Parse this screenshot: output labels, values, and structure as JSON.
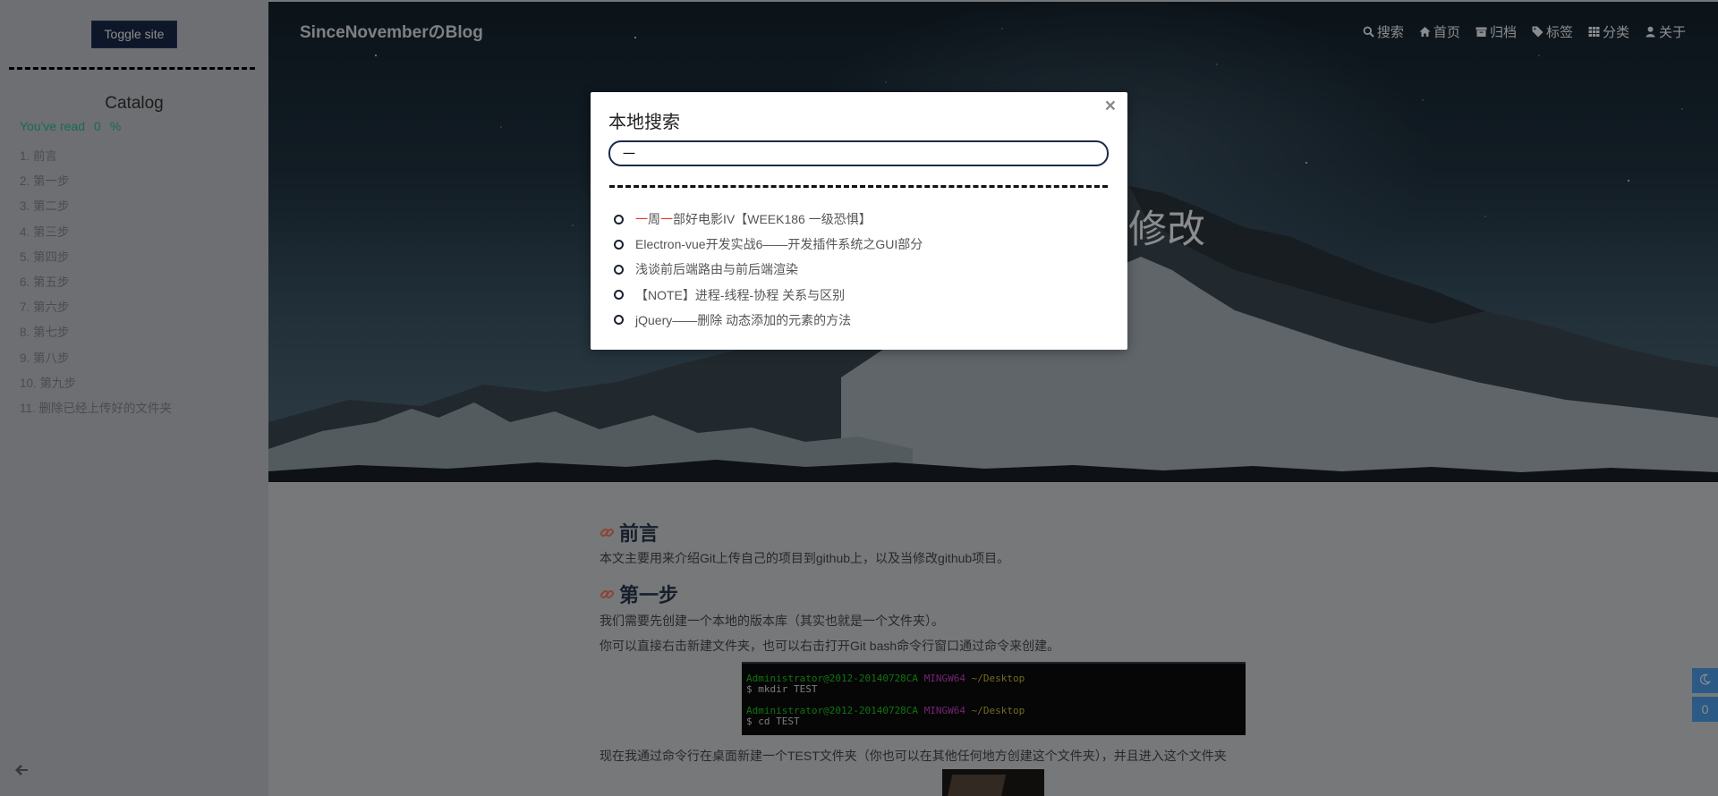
{
  "colors": {
    "accent": "#192a4b",
    "highlight": "#e8352c",
    "read_progress": "#2fc48e",
    "float_button": "#4ea4f2"
  },
  "sidebar": {
    "toggle_label": "Toggle site",
    "catalog_title": "Catalog",
    "progress": {
      "prefix": "You've read",
      "value": "0",
      "suffix": "%"
    },
    "items": [
      "1. 前言",
      "2. 第一步",
      "3. 第二步",
      "4. 第三步",
      "5. 第四步",
      "6. 第五步",
      "7. 第六步",
      "8. 第七步",
      "9. 第八步",
      "10. 第九步",
      "11. 删除已经上传好的文件夹"
    ],
    "back_icon": "arrow-left-icon"
  },
  "nav": {
    "brand": "SinceNovemberのBlog",
    "items": [
      {
        "icon": "search-icon",
        "label": "搜索"
      },
      {
        "icon": "home-icon",
        "label": "首页"
      },
      {
        "icon": "archive-icon",
        "label": "归档"
      },
      {
        "icon": "tag-icon",
        "label": "标签"
      },
      {
        "icon": "grid-icon",
        "label": "分类"
      },
      {
        "icon": "user-icon",
        "label": "关于"
      }
    ]
  },
  "hero": {
    "title_visible": "修改"
  },
  "search": {
    "title": "本地搜索",
    "close_label": "×",
    "query": "一",
    "results": [
      {
        "parts": [
          {
            "text": "一",
            "match": true
          },
          {
            "text": "周",
            "match": false
          },
          {
            "text": "一",
            "match": true
          },
          {
            "text": "部好电影IV【WEEK186 一级恐惧】",
            "match": false
          }
        ]
      },
      {
        "parts": [
          {
            "text": "Electron-vue开发实战6——开发插件系统之GUI部分",
            "match": false
          }
        ]
      },
      {
        "parts": [
          {
            "text": "浅谈前后端路由与前后端渲染",
            "match": false
          }
        ]
      },
      {
        "parts": [
          {
            "text": "【NOTE】进程-线程-协程 关系与区别",
            "match": false
          }
        ]
      },
      {
        "parts": [
          {
            "text": "jQuery——删除 动态添加的元素的方法",
            "match": false
          }
        ]
      }
    ]
  },
  "article": {
    "sections": [
      {
        "heading": "前言",
        "paragraphs": [
          "本文主要用来介绍Git上传自己的项目到github上，以及当修改github项目。"
        ]
      },
      {
        "heading": "第一步",
        "paragraphs": [
          "我们需要先创建一个本地的版本库（其实也就是一个文件夹）。",
          "你可以直接右击新建文件夹，也可以右击打开Git bash命令行窗口通过命令来创建。"
        ]
      }
    ],
    "terminal": {
      "prompt_user": "Administrator@2012-20140728CA",
      "prompt_sys": "MINGW64",
      "prompt_path": "~/Desktop",
      "cmd1": "$ mkdir TEST",
      "cmd2": "$ cd TEST"
    },
    "after_terminal": "现在我通过命令行在桌面新建一个TEST文件夹（你也可以在其他任何地方创建这个文件夹），并且进入这个文件夹"
  },
  "float_buttons": {
    "theme_icon": "moon-icon",
    "count": "0"
  }
}
